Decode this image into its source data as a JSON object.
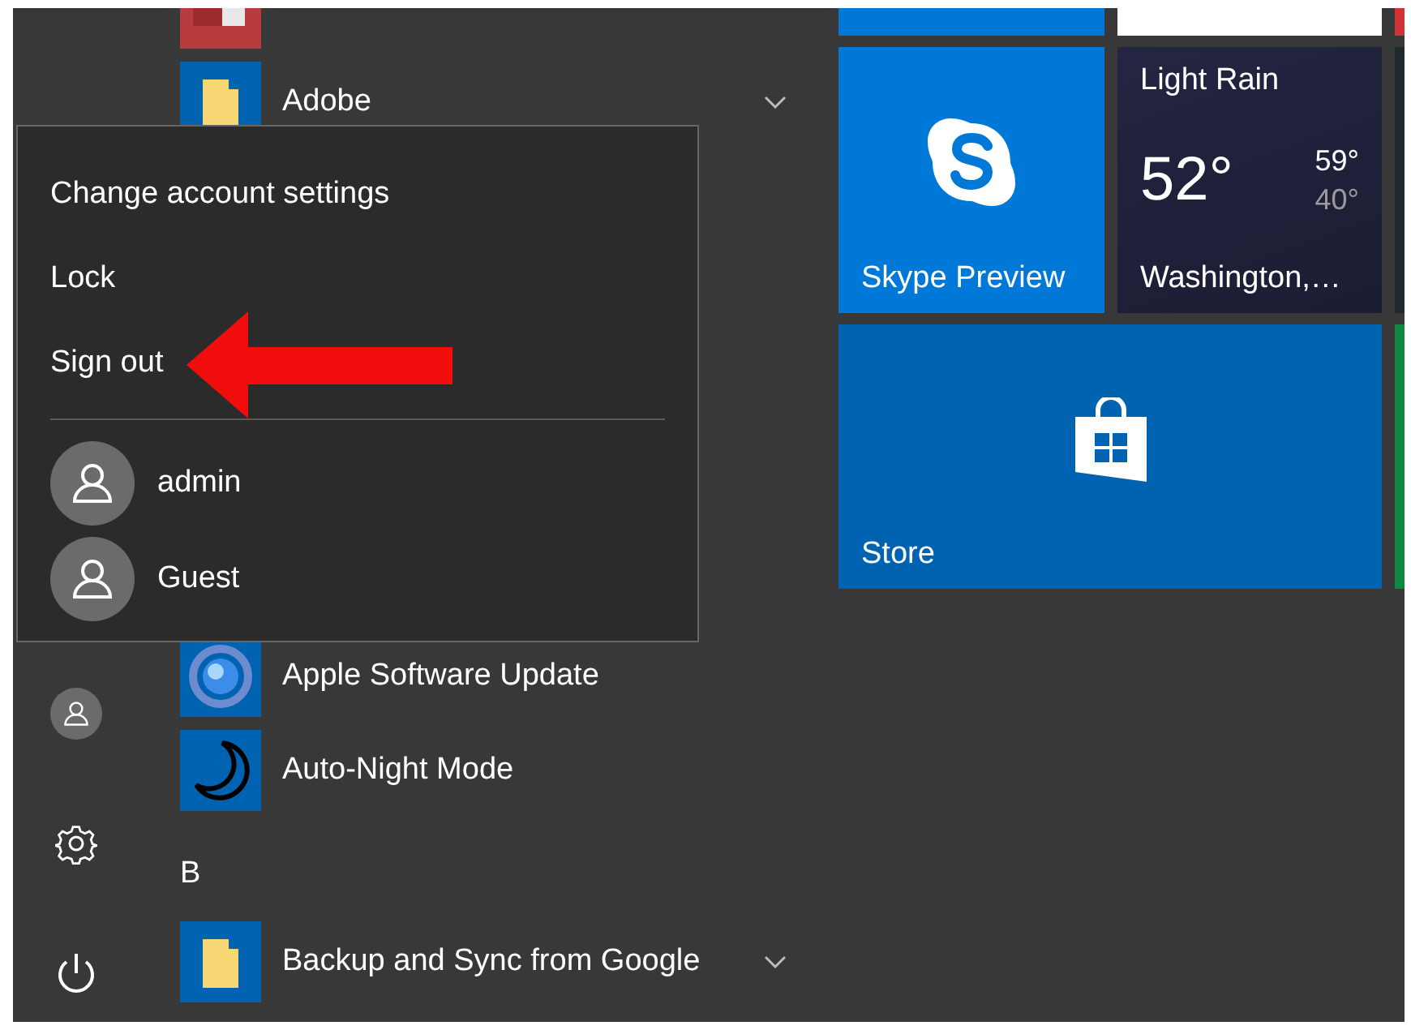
{
  "apps": [
    {
      "kind": "app",
      "label": "Adobe",
      "expandable": true
    },
    {
      "kind": "app",
      "label": "Apple Software Update",
      "expandable": false
    },
    {
      "kind": "app",
      "label": "Auto-Night Mode",
      "expandable": false
    },
    {
      "kind": "header",
      "label": "B"
    },
    {
      "kind": "app",
      "label": "Backup and Sync from Google",
      "expandable": true
    }
  ],
  "account_menu": {
    "items": [
      {
        "label": "Change account settings",
        "highlighted": false
      },
      {
        "label": "Lock",
        "highlighted": false
      },
      {
        "label": "Sign out",
        "highlighted": true
      }
    ],
    "users": [
      {
        "name": "admin"
      },
      {
        "name": "Guest"
      }
    ]
  },
  "tiles": [
    {
      "kind": "skype",
      "label": "Skype Preview"
    },
    {
      "kind": "weather",
      "condition": "Light Rain",
      "temperature": "52°",
      "high": "59°",
      "low": "40°",
      "location": "Washington,…"
    },
    {
      "kind": "store",
      "label": "Store"
    }
  ]
}
